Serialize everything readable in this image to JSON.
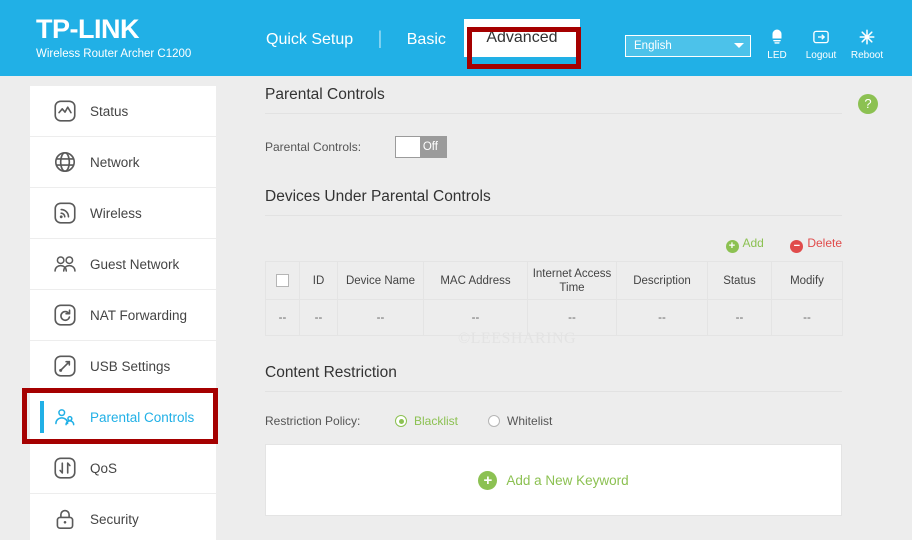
{
  "header": {
    "logo": "TP-LINK",
    "model": "Wireless Router Archer C1200",
    "nav": [
      {
        "label": "Quick Setup",
        "active": false
      },
      {
        "label": "Basic",
        "active": false
      },
      {
        "label": "Advanced",
        "active": true
      }
    ],
    "separator": "|",
    "language": {
      "value": "English"
    },
    "tools": [
      {
        "name": "led",
        "label": "LED",
        "icon": "led-icon"
      },
      {
        "name": "logout",
        "label": "Logout",
        "icon": "logout-icon"
      },
      {
        "name": "reboot",
        "label": "Reboot",
        "icon": "reboot-icon"
      }
    ]
  },
  "sidebar": {
    "items": [
      {
        "label": "Status",
        "icon": "status-icon",
        "active": false
      },
      {
        "label": "Network",
        "icon": "globe-icon",
        "active": false
      },
      {
        "label": "Wireless",
        "icon": "wireless-icon",
        "active": false
      },
      {
        "label": "Guest Network",
        "icon": "guest-network-icon",
        "active": false
      },
      {
        "label": "NAT Forwarding",
        "icon": "nat-forwarding-icon",
        "active": false
      },
      {
        "label": "USB Settings",
        "icon": "usb-settings-icon",
        "active": false
      },
      {
        "label": "Parental Controls",
        "icon": "parental-controls-icon",
        "active": true
      },
      {
        "label": "QoS",
        "icon": "qos-icon",
        "active": false
      },
      {
        "label": "Security",
        "icon": "lock-icon",
        "active": false
      }
    ]
  },
  "content": {
    "help_label": "?",
    "parental_controls": {
      "title": "Parental Controls",
      "field_label": "Parental Controls:",
      "toggle_state": "Off"
    },
    "devices": {
      "title": "Devices Under Parental Controls",
      "add_label": "Add",
      "add_glyph": "+",
      "delete_label": "Delete",
      "delete_glyph": "−",
      "columns": [
        "",
        "ID",
        "Device Name",
        "MAC Address",
        "Internet Access Time",
        "Description",
        "Status",
        "Modify"
      ],
      "rows": [
        [
          "--",
          "--",
          "--",
          "--",
          "--",
          "--",
          "--",
          "--"
        ]
      ]
    },
    "content_restriction": {
      "title": "Content Restriction",
      "policy_label": "Restriction Policy:",
      "options": [
        {
          "label": "Blacklist",
          "selected": true
        },
        {
          "label": "Whitelist",
          "selected": false
        }
      ],
      "add_keyword_label": "Add a New Keyword",
      "add_keyword_glyph": "+"
    }
  },
  "watermark": "©LEESHARING",
  "colors": {
    "brand_blue": "#21b0e6",
    "accent_green": "#8cc152",
    "danger_red": "#e04b4b",
    "highlight_red": "#a50000"
  }
}
